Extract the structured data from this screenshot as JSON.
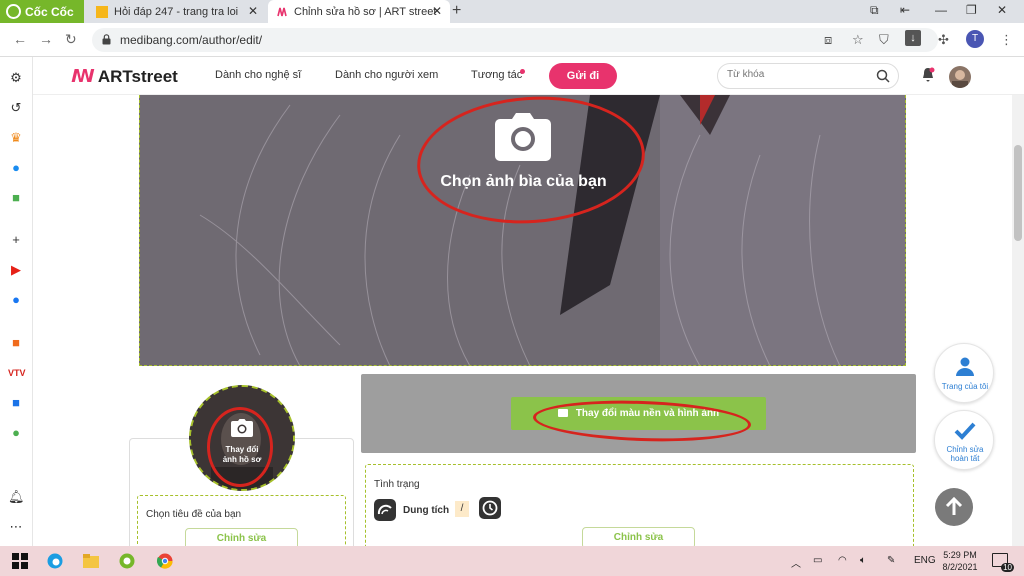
{
  "browser": {
    "brand": "Cốc Cốc",
    "tabs": [
      {
        "title": "Hỏi đáp 247 - trang tra loi"
      },
      {
        "title": "Chỉnh sửa hồ sơ | ART street"
      }
    ],
    "url": "medibang.com/author/edit/",
    "profile_initial": "T"
  },
  "header": {
    "logo_text": "ARTstreet",
    "nav": [
      "Dành cho nghệ sĩ",
      "Dành cho người xem",
      "Tương tác"
    ],
    "submit_label": "Gửi đi",
    "search_placeholder": "Từ khóa"
  },
  "cover": {
    "prompt": "Chọn ảnh bìa của bạn"
  },
  "profile": {
    "photo_prompt_line1": "Thay đổi",
    "photo_prompt_line2": "ảnh hồ sơ",
    "title_label": "Chọn tiêu đề của bạn",
    "edit_label": "Chỉnh sửa"
  },
  "theme": {
    "change_label": "Thay đổi màu nền và hình ảnh"
  },
  "status": {
    "label": "Tình trạng",
    "capacity_label": "Dung tích",
    "slash": "/",
    "edit_label": "Chỉnh sửa"
  },
  "right_actions": {
    "my_page": "Trang của tôi",
    "edit_done_line1": "Chỉnh sửa",
    "edit_done_line2": "hoàn tất"
  },
  "taskbar": {
    "lang": "ENG",
    "time": "5:29 PM",
    "date": "8/2/2021",
    "notif_count": "10"
  },
  "colors": {
    "brand_pink": "#e8336d",
    "accent_green": "#8bc34a",
    "annotation_red": "#d6241e",
    "link_blue": "#2d7fd3"
  }
}
